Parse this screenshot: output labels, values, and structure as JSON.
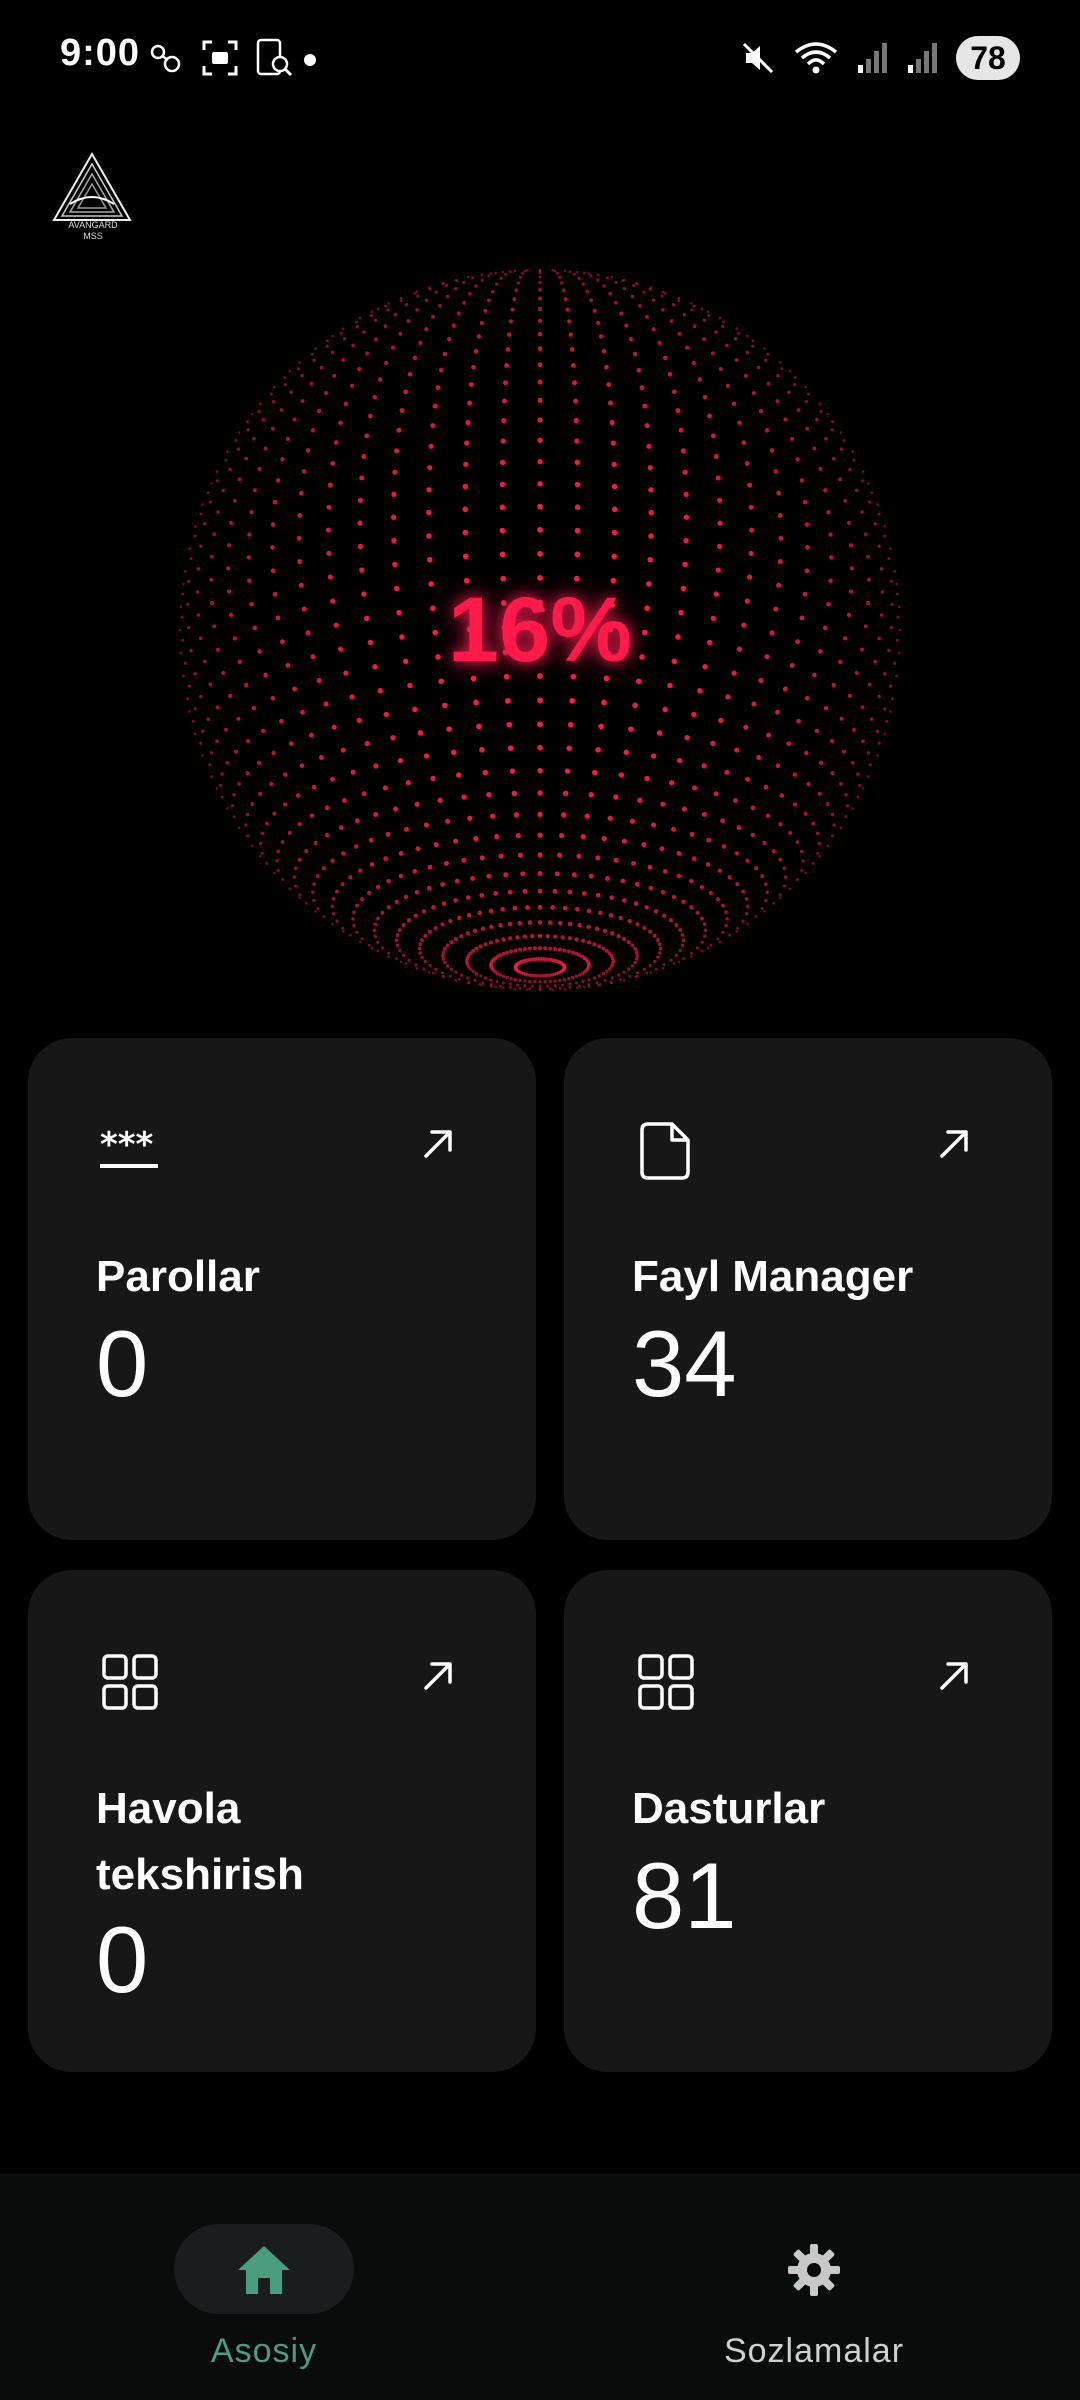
{
  "status_bar": {
    "time": "9:00",
    "battery": "78"
  },
  "logo": {
    "line1": "AVANGARD",
    "line2": "MSS"
  },
  "progress": {
    "label": "16%",
    "value": 0.16
  },
  "cards": [
    {
      "title": "Parollar",
      "value": "0",
      "icon": "password-dots-icon"
    },
    {
      "title": "Fayl Manager",
      "value": "34",
      "icon": "file-icon"
    },
    {
      "title": "Havola tekshirish",
      "value": "0",
      "icon": "grid-icon"
    },
    {
      "title": "Dasturlar",
      "value": "81",
      "icon": "grid-icon"
    }
  ],
  "bottom_nav": {
    "home_label": "Asosiy",
    "settings_label": "Sozlamalar",
    "active": "home"
  },
  "colors": {
    "accent_green": "#4a9d7e",
    "sphere_red": "#ff1a4a",
    "card_bg": "#171717"
  }
}
